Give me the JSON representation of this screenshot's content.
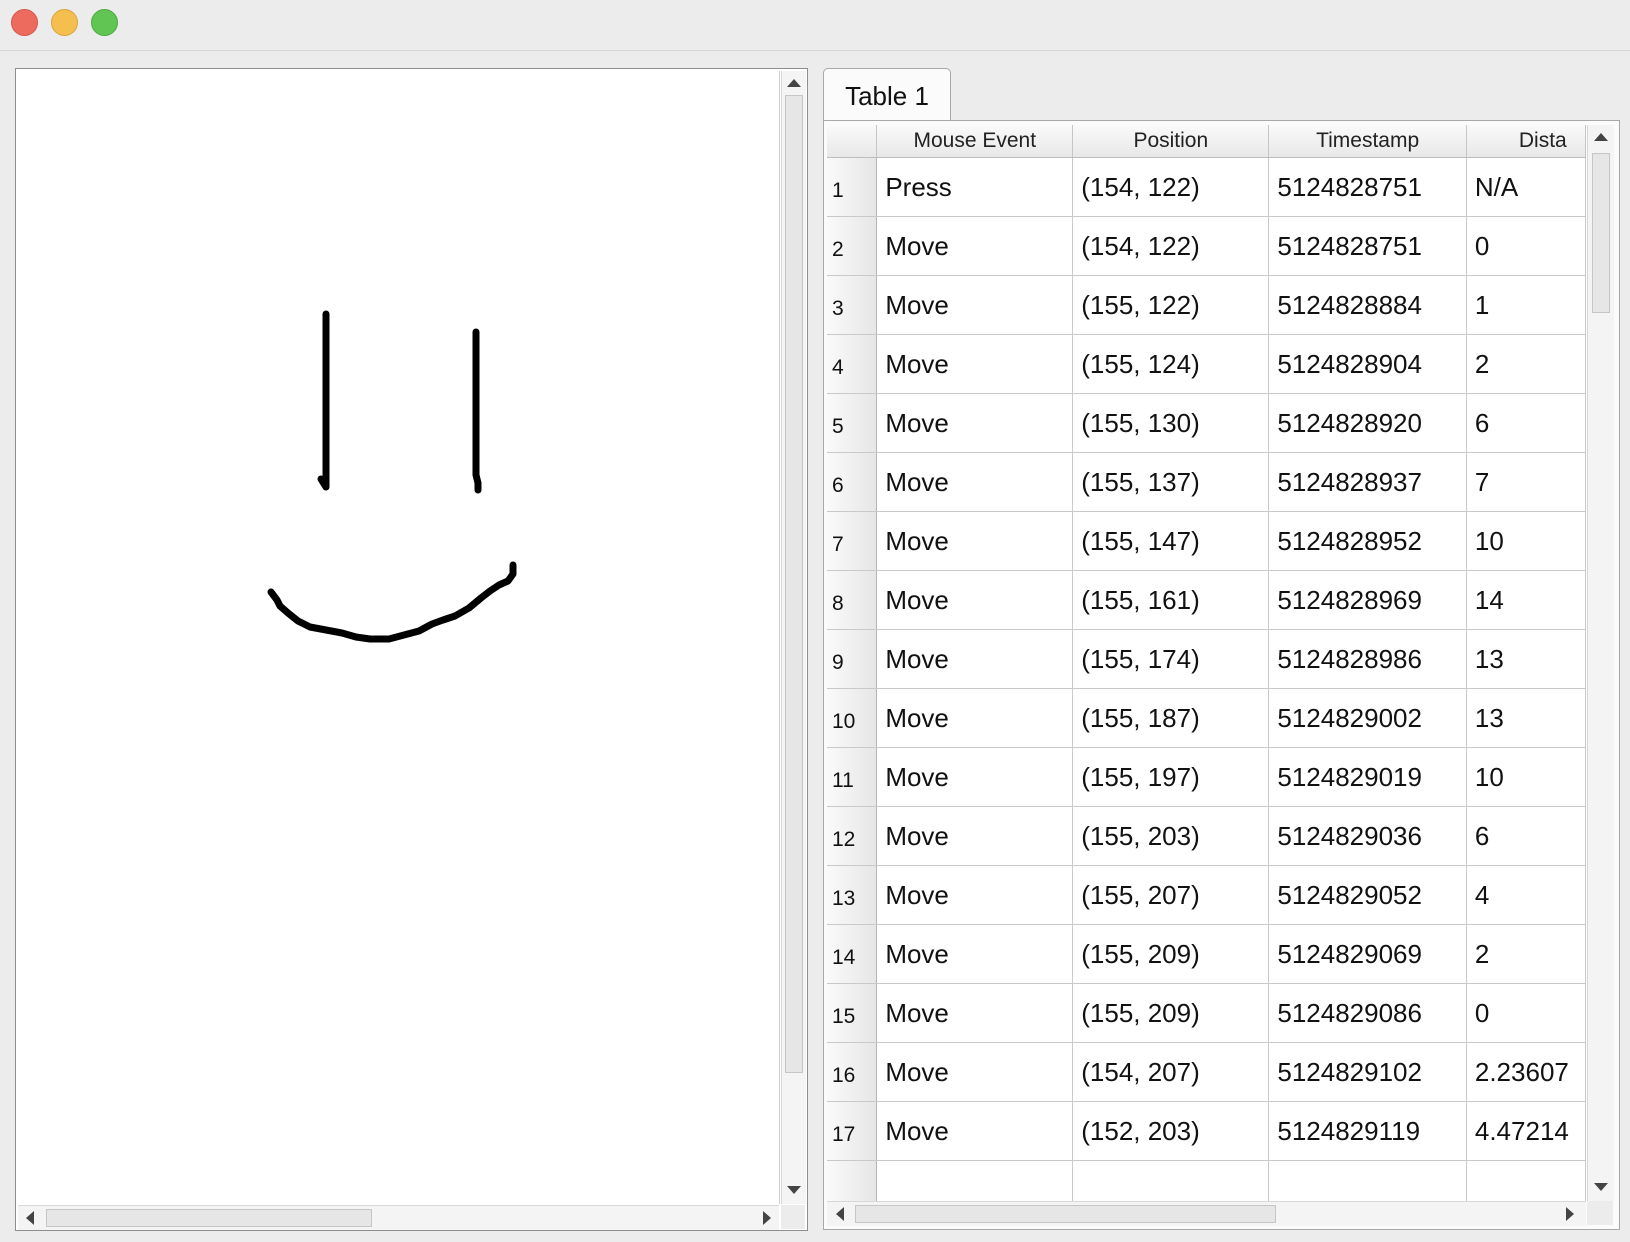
{
  "window": {
    "buttons": [
      "close",
      "minimize",
      "zoom"
    ]
  },
  "canvas": {
    "description_icon": "smiley-drawing",
    "stroke_color": "#000000"
  },
  "tabs": [
    {
      "label": "Table 1",
      "selected": true
    }
  ],
  "table": {
    "columns": [
      "",
      "Mouse Event",
      "Position",
      "Timestamp",
      "Dista"
    ],
    "rows": [
      {
        "num": "1",
        "event": "Press",
        "position": "(154, 122)",
        "timestamp": "5124828751",
        "distance": "N/A"
      },
      {
        "num": "2",
        "event": "Move",
        "position": "(154, 122)",
        "timestamp": "5124828751",
        "distance": "0"
      },
      {
        "num": "3",
        "event": "Move",
        "position": "(155, 122)",
        "timestamp": "5124828884",
        "distance": "1"
      },
      {
        "num": "4",
        "event": "Move",
        "position": "(155, 124)",
        "timestamp": "5124828904",
        "distance": "2"
      },
      {
        "num": "5",
        "event": "Move",
        "position": "(155, 130)",
        "timestamp": "5124828920",
        "distance": "6"
      },
      {
        "num": "6",
        "event": "Move",
        "position": "(155, 137)",
        "timestamp": "5124828937",
        "distance": "7"
      },
      {
        "num": "7",
        "event": "Move",
        "position": "(155, 147)",
        "timestamp": "5124828952",
        "distance": "10"
      },
      {
        "num": "8",
        "event": "Move",
        "position": "(155, 161)",
        "timestamp": "5124828969",
        "distance": "14"
      },
      {
        "num": "9",
        "event": "Move",
        "position": "(155, 174)",
        "timestamp": "5124828986",
        "distance": "13"
      },
      {
        "num": "10",
        "event": "Move",
        "position": "(155, 187)",
        "timestamp": "5124829002",
        "distance": "13"
      },
      {
        "num": "11",
        "event": "Move",
        "position": "(155, 197)",
        "timestamp": "5124829019",
        "distance": "10"
      },
      {
        "num": "12",
        "event": "Move",
        "position": "(155, 203)",
        "timestamp": "5124829036",
        "distance": "6"
      },
      {
        "num": "13",
        "event": "Move",
        "position": "(155, 207)",
        "timestamp": "5124829052",
        "distance": "4"
      },
      {
        "num": "14",
        "event": "Move",
        "position": "(155, 209)",
        "timestamp": "5124829069",
        "distance": "2"
      },
      {
        "num": "15",
        "event": "Move",
        "position": "(155, 209)",
        "timestamp": "5124829086",
        "distance": "0"
      },
      {
        "num": "16",
        "event": "Move",
        "position": "(154, 207)",
        "timestamp": "5124829102",
        "distance": "2.23607"
      },
      {
        "num": "17",
        "event": "Move",
        "position": "(152, 203)",
        "timestamp": "5124829119",
        "distance": "4.47214"
      }
    ]
  }
}
